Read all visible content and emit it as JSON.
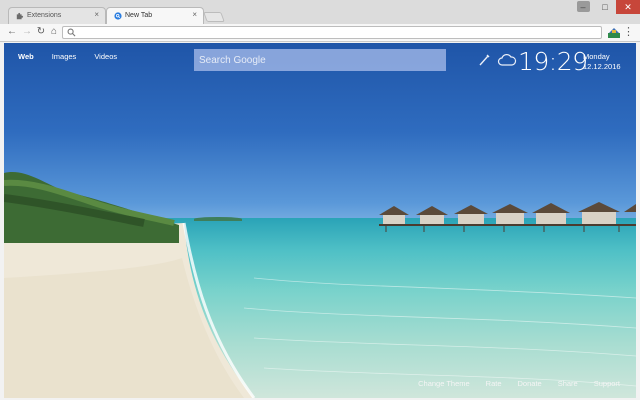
{
  "browser": {
    "tabs": [
      {
        "label": "Extensions",
        "icon": "puzzle-icon"
      },
      {
        "label": "New Tab",
        "icon": "newtab-icon"
      }
    ],
    "tab_close": "×",
    "window_buttons": {
      "minimize": "–",
      "maximize": "□",
      "close": "✕"
    },
    "nav": {
      "back": "←",
      "forward": "→",
      "reload": "↻",
      "home": "⌂"
    },
    "address_value": "",
    "menu": "⋮"
  },
  "page": {
    "search_nav": [
      "Web",
      "Images",
      "Videos"
    ],
    "search_placeholder": "Search Google",
    "clock": {
      "time": "19:29",
      "day": "Monday",
      "date": "12.12.2016"
    },
    "footer_links": [
      "Change Theme",
      "Rate",
      "Donate",
      "Share",
      "Support"
    ]
  },
  "colors": {
    "accent_blue": "#2a7de0",
    "close_red": "#c7463a"
  }
}
